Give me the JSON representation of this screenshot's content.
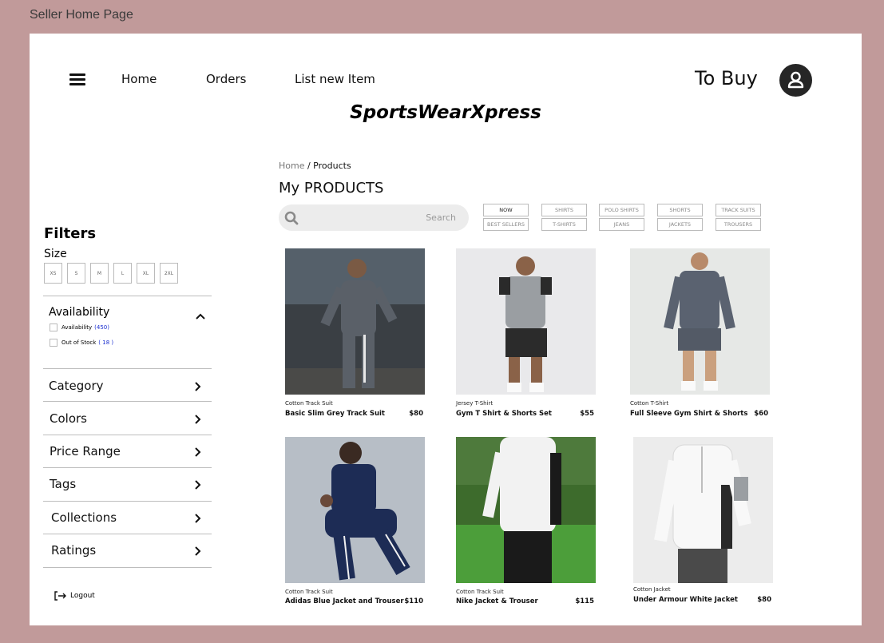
{
  "frame_title": "Seller Home Page",
  "header": {
    "nav": [
      "Home",
      "Orders",
      "List new Item"
    ],
    "to_buy": "To Buy",
    "brand": "SportsWearXpress"
  },
  "sidebar": {
    "filters_title": "Filters",
    "size_label": "Size",
    "sizes": [
      "XS",
      "S",
      "M",
      "L",
      "XL",
      "2XL"
    ],
    "availability": {
      "title": "Availability",
      "options": [
        {
          "label": "Availability",
          "count": "450"
        },
        {
          "label": "Out of Stock",
          "count": "18"
        }
      ]
    },
    "sections": [
      "Category",
      "Colors",
      "Price Range",
      "Tags",
      "Collections",
      "Ratings"
    ],
    "logout": "Logout"
  },
  "main": {
    "breadcrumb": {
      "home": "Home",
      "current": "/ Products"
    },
    "title": "My PRODUCTS",
    "search_placeholder": "Search",
    "chips_top": [
      "NOW",
      "SHIRTS",
      "POLO SHIRTS",
      "SHORTS",
      "TRACK SUITS"
    ],
    "chips_bottom": [
      "Best Sellers",
      "T-SHIRTS",
      "JEANS",
      "JACKETS",
      "TROUSERS"
    ],
    "products": [
      {
        "category": "Cotton Track Suit",
        "name": "Basic Slim Grey Track Suit",
        "price": "$80"
      },
      {
        "category": "Jersey T-Shirt",
        "name": "Gym T Shirt & Shorts Set",
        "price": "$55"
      },
      {
        "category": "Cotton T-Shirt",
        "name": "Full Sleeve Gym Shirt & Shorts",
        "price": "$60"
      },
      {
        "category": "Cotton Track Suit",
        "name": "Adidas Blue Jacket and Trouser",
        "price": "$110"
      },
      {
        "category": "Cotton Track Suit",
        "name": "Nike Jacket & Trouser",
        "price": "$115"
      },
      {
        "category": "Cotton Jacket",
        "name": "Under Armour White Jacket",
        "price": "$80"
      }
    ]
  },
  "colors": {
    "frame_bg": "#c19a9a",
    "accent_count": "#1a2fd0"
  }
}
